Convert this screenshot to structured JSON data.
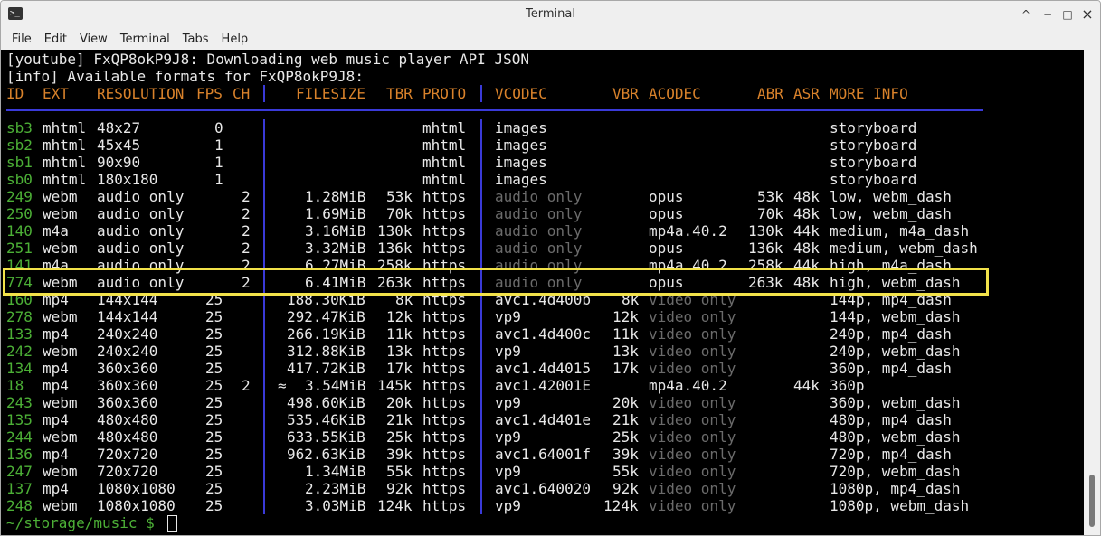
{
  "window": {
    "title": "Terminal",
    "minimize": "^",
    "restore": "−",
    "maximize": "□",
    "close": "×"
  },
  "menu": [
    "File",
    "Edit",
    "View",
    "Terminal",
    "Tabs",
    "Help"
  ],
  "terminal": {
    "log_lines": [
      "[youtube] FxQP8okP9J8: Downloading web music player API JSON",
      "[info] Available formats for FxQP8okP9J8:"
    ],
    "headers": {
      "id": "ID",
      "ext": "EXT",
      "resolution": "RESOLUTION",
      "fps": "FPS",
      "ch": "CH",
      "filesize": "FILESIZE",
      "tbr": "TBR",
      "proto": "PROTO",
      "vcodec": "VCODEC",
      "vbr": "VBR",
      "acodec": "ACODEC",
      "abr": "ABR",
      "asr": "ASR",
      "more": "MORE INFO"
    },
    "rows": [
      {
        "id": "sb3",
        "ext": "mhtml",
        "res": "48x27",
        "fps": "0",
        "ch": "",
        "approx": "",
        "size": "",
        "tbr": "",
        "proto": "mhtml",
        "vcodec": "images",
        "vdim": false,
        "vbr": "",
        "acodec": "",
        "adim": false,
        "abr": "",
        "asr": "",
        "more": "storyboard"
      },
      {
        "id": "sb2",
        "ext": "mhtml",
        "res": "45x45",
        "fps": "1",
        "ch": "",
        "approx": "",
        "size": "",
        "tbr": "",
        "proto": "mhtml",
        "vcodec": "images",
        "vdim": false,
        "vbr": "",
        "acodec": "",
        "adim": false,
        "abr": "",
        "asr": "",
        "more": "storyboard"
      },
      {
        "id": "sb1",
        "ext": "mhtml",
        "res": "90x90",
        "fps": "1",
        "ch": "",
        "approx": "",
        "size": "",
        "tbr": "",
        "proto": "mhtml",
        "vcodec": "images",
        "vdim": false,
        "vbr": "",
        "acodec": "",
        "adim": false,
        "abr": "",
        "asr": "",
        "more": "storyboard"
      },
      {
        "id": "sb0",
        "ext": "mhtml",
        "res": "180x180",
        "fps": "1",
        "ch": "",
        "approx": "",
        "size": "",
        "tbr": "",
        "proto": "mhtml",
        "vcodec": "images",
        "vdim": false,
        "vbr": "",
        "acodec": "",
        "adim": false,
        "abr": "",
        "asr": "",
        "more": "storyboard"
      },
      {
        "id": "249",
        "ext": "webm",
        "res": "audio only",
        "fps": "",
        "ch": "2",
        "approx": "",
        "size": "1.28MiB",
        "tbr": "53k",
        "proto": "https",
        "vcodec": "audio only",
        "vdim": true,
        "vbr": "",
        "acodec": "opus",
        "adim": false,
        "abr": "53k",
        "asr": "48k",
        "more": "low, webm_dash"
      },
      {
        "id": "250",
        "ext": "webm",
        "res": "audio only",
        "fps": "",
        "ch": "2",
        "approx": "",
        "size": "1.69MiB",
        "tbr": "70k",
        "proto": "https",
        "vcodec": "audio only",
        "vdim": true,
        "vbr": "",
        "acodec": "opus",
        "adim": false,
        "abr": "70k",
        "asr": "48k",
        "more": "low, webm_dash"
      },
      {
        "id": "140",
        "ext": "m4a",
        "res": "audio only",
        "fps": "",
        "ch": "2",
        "approx": "",
        "size": "3.16MiB",
        "tbr": "130k",
        "proto": "https",
        "vcodec": "audio only",
        "vdim": true,
        "vbr": "",
        "acodec": "mp4a.40.2",
        "adim": false,
        "abr": "130k",
        "asr": "44k",
        "more": "medium, m4a_dash"
      },
      {
        "id": "251",
        "ext": "webm",
        "res": "audio only",
        "fps": "",
        "ch": "2",
        "approx": "",
        "size": "3.32MiB",
        "tbr": "136k",
        "proto": "https",
        "vcodec": "audio only",
        "vdim": true,
        "vbr": "",
        "acodec": "opus",
        "adim": false,
        "abr": "136k",
        "asr": "48k",
        "more": "medium, webm_dash"
      },
      {
        "id": "141",
        "ext": "m4a",
        "res": "audio only",
        "fps": "",
        "ch": "2",
        "approx": "",
        "size": "6.27MiB",
        "tbr": "258k",
        "proto": "https",
        "vcodec": "audio only",
        "vdim": true,
        "vbr": "",
        "acodec": "mp4a.40.2",
        "adim": false,
        "abr": "258k",
        "asr": "44k",
        "more": "high, m4a_dash"
      },
      {
        "id": "774",
        "ext": "webm",
        "res": "audio only",
        "fps": "",
        "ch": "2",
        "approx": "",
        "size": "6.41MiB",
        "tbr": "263k",
        "proto": "https",
        "vcodec": "audio only",
        "vdim": true,
        "vbr": "",
        "acodec": "opus",
        "adim": false,
        "abr": "263k",
        "asr": "48k",
        "more": "high, webm_dash"
      },
      {
        "id": "160",
        "ext": "mp4",
        "res": "144x144",
        "fps": "25",
        "ch": "",
        "approx": "",
        "size": "188.30KiB",
        "tbr": "8k",
        "proto": "https",
        "vcodec": "avc1.4d400b",
        "vdim": false,
        "vbr": "8k",
        "acodec": "video only",
        "adim": true,
        "abr": "",
        "asr": "",
        "more": "144p, mp4_dash"
      },
      {
        "id": "278",
        "ext": "webm",
        "res": "144x144",
        "fps": "25",
        "ch": "",
        "approx": "",
        "size": "292.47KiB",
        "tbr": "12k",
        "proto": "https",
        "vcodec": "vp9",
        "vdim": false,
        "vbr": "12k",
        "acodec": "video only",
        "adim": true,
        "abr": "",
        "asr": "",
        "more": "144p, webm_dash"
      },
      {
        "id": "133",
        "ext": "mp4",
        "res": "240x240",
        "fps": "25",
        "ch": "",
        "approx": "",
        "size": "266.19KiB",
        "tbr": "11k",
        "proto": "https",
        "vcodec": "avc1.4d400c",
        "vdim": false,
        "vbr": "11k",
        "acodec": "video only",
        "adim": true,
        "abr": "",
        "asr": "",
        "more": "240p, mp4_dash"
      },
      {
        "id": "242",
        "ext": "webm",
        "res": "240x240",
        "fps": "25",
        "ch": "",
        "approx": "",
        "size": "312.88KiB",
        "tbr": "13k",
        "proto": "https",
        "vcodec": "vp9",
        "vdim": false,
        "vbr": "13k",
        "acodec": "video only",
        "adim": true,
        "abr": "",
        "asr": "",
        "more": "240p, webm_dash"
      },
      {
        "id": "134",
        "ext": "mp4",
        "res": "360x360",
        "fps": "25",
        "ch": "",
        "approx": "",
        "size": "417.72KiB",
        "tbr": "17k",
        "proto": "https",
        "vcodec": "avc1.4d4015",
        "vdim": false,
        "vbr": "17k",
        "acodec": "video only",
        "adim": true,
        "abr": "",
        "asr": "",
        "more": "360p, mp4_dash"
      },
      {
        "id": "18",
        "ext": "mp4",
        "res": "360x360",
        "fps": "25",
        "ch": "2",
        "approx": "≈",
        "size": "3.54MiB",
        "tbr": "145k",
        "proto": "https",
        "vcodec": "avc1.42001E",
        "vdim": false,
        "vbr": "",
        "acodec": "mp4a.40.2",
        "adim": false,
        "abr": "",
        "asr": "44k",
        "more": "360p"
      },
      {
        "id": "243",
        "ext": "webm",
        "res": "360x360",
        "fps": "25",
        "ch": "",
        "approx": "",
        "size": "498.60KiB",
        "tbr": "20k",
        "proto": "https",
        "vcodec": "vp9",
        "vdim": false,
        "vbr": "20k",
        "acodec": "video only",
        "adim": true,
        "abr": "",
        "asr": "",
        "more": "360p, webm_dash"
      },
      {
        "id": "135",
        "ext": "mp4",
        "res": "480x480",
        "fps": "25",
        "ch": "",
        "approx": "",
        "size": "535.46KiB",
        "tbr": "21k",
        "proto": "https",
        "vcodec": "avc1.4d401e",
        "vdim": false,
        "vbr": "21k",
        "acodec": "video only",
        "adim": true,
        "abr": "",
        "asr": "",
        "more": "480p, mp4_dash"
      },
      {
        "id": "244",
        "ext": "webm",
        "res": "480x480",
        "fps": "25",
        "ch": "",
        "approx": "",
        "size": "633.55KiB",
        "tbr": "25k",
        "proto": "https",
        "vcodec": "vp9",
        "vdim": false,
        "vbr": "25k",
        "acodec": "video only",
        "adim": true,
        "abr": "",
        "asr": "",
        "more": "480p, webm_dash"
      },
      {
        "id": "136",
        "ext": "mp4",
        "res": "720x720",
        "fps": "25",
        "ch": "",
        "approx": "",
        "size": "962.63KiB",
        "tbr": "39k",
        "proto": "https",
        "vcodec": "avc1.64001f",
        "vdim": false,
        "vbr": "39k",
        "acodec": "video only",
        "adim": true,
        "abr": "",
        "asr": "",
        "more": "720p, mp4_dash"
      },
      {
        "id": "247",
        "ext": "webm",
        "res": "720x720",
        "fps": "25",
        "ch": "",
        "approx": "",
        "size": "1.34MiB",
        "tbr": "55k",
        "proto": "https",
        "vcodec": "vp9",
        "vdim": false,
        "vbr": "55k",
        "acodec": "video only",
        "adim": true,
        "abr": "",
        "asr": "",
        "more": "720p, webm_dash"
      },
      {
        "id": "137",
        "ext": "mp4",
        "res": "1080x1080",
        "fps": "25",
        "ch": "",
        "approx": "",
        "size": "2.23MiB",
        "tbr": "92k",
        "proto": "https",
        "vcodec": "avc1.640020",
        "vdim": false,
        "vbr": "92k",
        "acodec": "video only",
        "adim": true,
        "abr": "",
        "asr": "",
        "more": "1080p, mp4_dash"
      },
      {
        "id": "248",
        "ext": "webm",
        "res": "1080x1080",
        "fps": "25",
        "ch": "",
        "approx": "",
        "size": "3.03MiB",
        "tbr": "124k",
        "proto": "https",
        "vcodec": "vp9",
        "vdim": false,
        "vbr": "124k",
        "acodec": "video only",
        "adim": true,
        "abr": "",
        "asr": "",
        "more": "1080p, webm_dash"
      }
    ],
    "prompt": "~/storage/music $"
  },
  "colors": {
    "header": "#d9822b",
    "id": "#4caf36",
    "separator": "#3a3ad8",
    "highlight": "#f2e24a"
  }
}
